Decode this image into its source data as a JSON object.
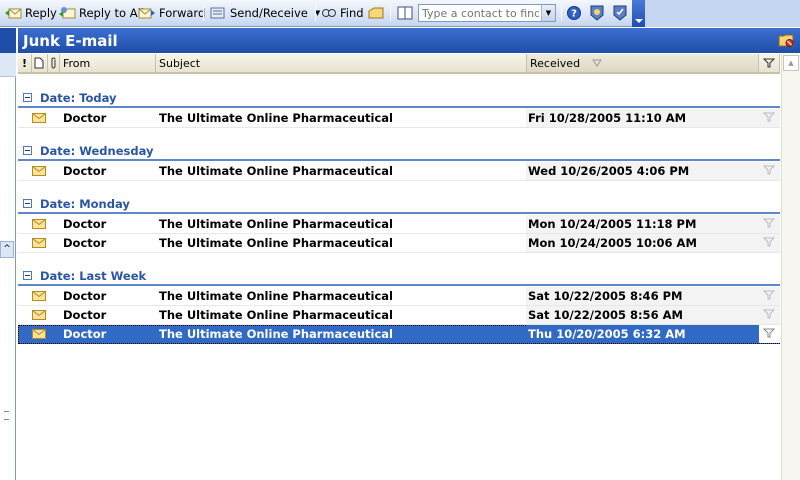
{
  "toolbar": {
    "reply": "Reply",
    "reply_all": "Reply to All",
    "forward": "Forward",
    "send_receive": "Send/Receive",
    "find": "Find",
    "contact_placeholder": "Type a contact to find"
  },
  "folder": {
    "title": "Junk E-mail"
  },
  "columns": {
    "importance": "!",
    "icon": "",
    "attachment": "",
    "from": "From",
    "subject": "Subject",
    "received": "Received",
    "flag": ""
  },
  "groups": [
    {
      "label": "Date: Today",
      "messages": [
        {
          "from": "Doctor",
          "subject": "The Ultimate Online Pharmaceutical",
          "received": "Fri 10/28/2005 11:10 AM"
        }
      ]
    },
    {
      "label": "Date: Wednesday",
      "messages": [
        {
          "from": "Doctor",
          "subject": "The Ultimate Online Pharmaceutical",
          "received": "Wed 10/26/2005 4:06 PM"
        }
      ]
    },
    {
      "label": "Date: Monday",
      "messages": [
        {
          "from": "Doctor",
          "subject": "The Ultimate Online Pharmaceutical",
          "received": "Mon 10/24/2005 11:18 PM"
        },
        {
          "from": "Doctor",
          "subject": "The Ultimate Online Pharmaceutical",
          "received": "Mon 10/24/2005 10:06 AM"
        }
      ]
    },
    {
      "label": "Date: Last Week",
      "messages": [
        {
          "from": "Doctor",
          "subject": "The Ultimate Online Pharmaceutical",
          "received": "Sat 10/22/2005 8:46 PM"
        },
        {
          "from": "Doctor",
          "subject": "The Ultimate Online Pharmaceutical",
          "received": "Sat 10/22/2005 8:56 AM"
        },
        {
          "from": "Doctor",
          "subject": "The Ultimate Online Pharmaceutical",
          "received": "Thu 10/20/2005 6:32 AM",
          "selected": true
        }
      ]
    }
  ],
  "colors": {
    "header_blue": "#1f4ea8",
    "group_text": "#2b55a3",
    "selection": "#316ac5"
  }
}
